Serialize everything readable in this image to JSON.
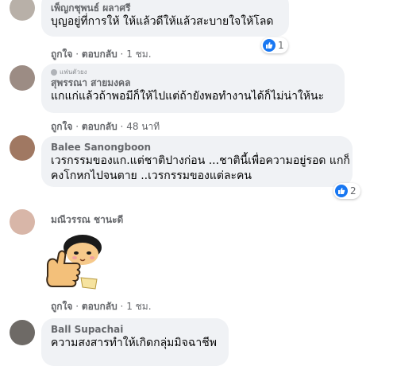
{
  "comments": [
    {
      "name": "เพ็ญกชุพนธ์ ผลาศรี",
      "text_lines": [
        "บุญอยู่ที่การให้ ให้แล้วดีให้แล้วสะบายใจให้โลด"
      ],
      "like_label": "ถูกใจ",
      "reply_label": "ตอบกลับ",
      "time": "1 ชม.",
      "reaction_count": "1",
      "avatar_color": "#b8b0a8"
    },
    {
      "badge": "แฟนตัวยง",
      "name": "สุพรรณา สายมงคล",
      "text_lines": [
        "แกแก่แล้วถ้าพอมีก็ให้ไปแต่ถ้ายังพอทำงานได้ก็ไม่น่าให้นะ"
      ],
      "like_label": "ถูกใจ",
      "reply_label": "ตอบกลับ",
      "time": "48 นาที",
      "avatar_color": "#9c8c84"
    },
    {
      "name": "Balee Sanongboon",
      "text_lines": [
        "เวรกรรมของแก.แต่ชาติปางก่อน ...ชาตินี้เพื่อความอยู่รอด แกก็",
        "คงโกหกไปจนตาย ..เวรกรรมของแต่ละคน"
      ],
      "reaction_count": "2",
      "avatar_color": "#a07862"
    },
    {
      "name": "มณีวรรณ ชานะดี",
      "like_label": "ถูกใจ",
      "reply_label": "ตอบกลับ",
      "time": "1 ชม.",
      "avatar_color": "#d8b6a8"
    },
    {
      "name": "Ball Supachai",
      "text_lines": [
        "ความสงสารทำให้เกิดกลุ่มมิจฉาชีพ"
      ],
      "avatar_color": "#6e6a66"
    }
  ],
  "colors": {
    "bubble": "#f0f2f5",
    "like_blue": "#1877f2",
    "meta_gray": "#65676b"
  },
  "icons": {
    "reaction": "like-icon",
    "sticker": "thumbs-up-sticker"
  }
}
